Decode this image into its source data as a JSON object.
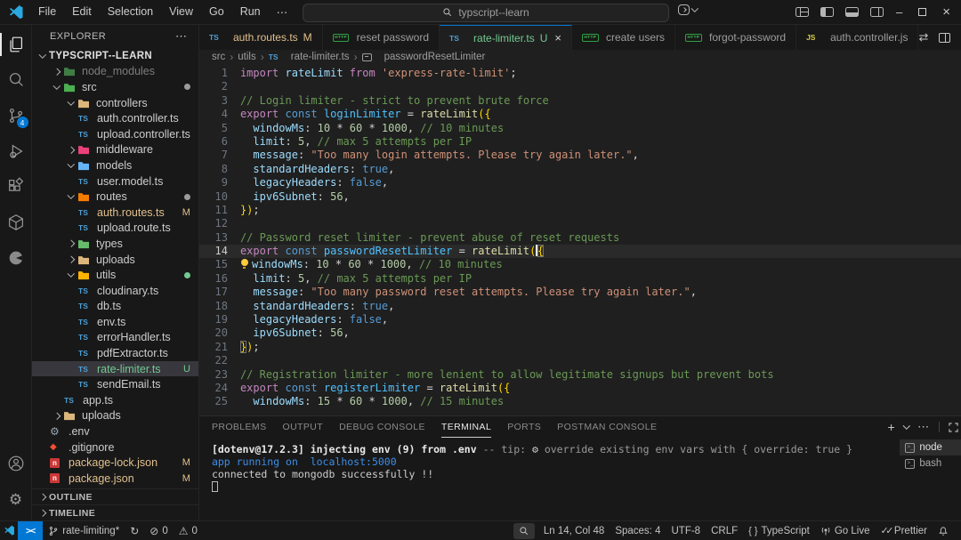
{
  "title_bar": {
    "menus": [
      "File",
      "Edit",
      "Selection",
      "View",
      "Go",
      "Run",
      "⋯"
    ],
    "back": "←",
    "forward": "→",
    "search_value": "typscript--learn",
    "window": {
      "minimize": "–",
      "close": "×"
    }
  },
  "activity_bar": {
    "source_control_badge": "4"
  },
  "explorer": {
    "header": "EXPLORER",
    "header_more": "⋯",
    "root": "TYPSCRIPT--LEARN",
    "tree": [
      {
        "label": "node_modules",
        "type": "folder",
        "color": "#3f7d44",
        "depth": 1,
        "chev": "right",
        "dim": true
      },
      {
        "label": "src",
        "type": "folder",
        "color": "#4caf50",
        "depth": 1,
        "chev": "down",
        "dot": "#9b9b9b"
      },
      {
        "label": "controllers",
        "type": "folder",
        "color": "#dcb67a",
        "depth": 2,
        "chev": "down"
      },
      {
        "label": "auth.controller.ts",
        "type": "ts",
        "depth": 3
      },
      {
        "label": "upload.controller.ts",
        "type": "ts",
        "depth": 3
      },
      {
        "label": "middleware",
        "type": "folder",
        "color": "#ec407a",
        "depth": 2,
        "chev": "right"
      },
      {
        "label": "models",
        "type": "folder",
        "color": "#64b5f6",
        "depth": 2,
        "chev": "down"
      },
      {
        "label": "user.model.ts",
        "type": "ts",
        "depth": 3
      },
      {
        "label": "routes",
        "type": "folder",
        "color": "#f57c00",
        "depth": 2,
        "chev": "down",
        "dot": "#9b9b9b"
      },
      {
        "label": "auth.routes.ts",
        "type": "ts",
        "depth": 3,
        "badge": "M",
        "label_color": "#e2c08d",
        "badge_color": "#e2c08d"
      },
      {
        "label": "upload.route.ts",
        "type": "ts",
        "depth": 3
      },
      {
        "label": "types",
        "type": "folder",
        "color": "#66bb6a",
        "depth": 2,
        "chev": "right"
      },
      {
        "label": "uploads",
        "type": "folder",
        "color": "#dcb67a",
        "depth": 2,
        "chev": "right"
      },
      {
        "label": "utils",
        "type": "folder",
        "color": "#ffb300",
        "depth": 2,
        "chev": "down",
        "dot": "#73c991"
      },
      {
        "label": "cloudinary.ts",
        "type": "ts",
        "depth": 3
      },
      {
        "label": "db.ts",
        "type": "ts",
        "depth": 3
      },
      {
        "label": "env.ts",
        "type": "ts",
        "depth": 3
      },
      {
        "label": "errorHandler.ts",
        "type": "ts",
        "depth": 3
      },
      {
        "label": "pdfExtractor.ts",
        "type": "ts",
        "depth": 3
      },
      {
        "label": "rate-limiter.ts",
        "type": "ts",
        "depth": 3,
        "badge": "U",
        "selected": true,
        "label_color": "#73c991",
        "badge_color": "#73c991"
      },
      {
        "label": "sendEmail.ts",
        "type": "ts",
        "depth": 3
      },
      {
        "label": "app.ts",
        "type": "ts",
        "depth": 2
      },
      {
        "label": "uploads",
        "type": "folder",
        "color": "#dcb67a",
        "depth": 1,
        "chev": "right"
      },
      {
        "label": ".env",
        "type": "gear",
        "depth": 1
      },
      {
        "label": ".gitignore",
        "type": "git",
        "depth": 1
      },
      {
        "label": "package-lock.json",
        "type": "npm",
        "depth": 1,
        "badge": "M",
        "label_color": "#e2c08d",
        "badge_color": "#e2c08d"
      },
      {
        "label": "package.json",
        "type": "npm",
        "depth": 1,
        "badge": "M",
        "label_color": "#e2c08d",
        "badge_color": "#e2c08d"
      }
    ],
    "sections": [
      "OUTLINE",
      "TIMELINE"
    ]
  },
  "tabs": [
    {
      "kind": "ts",
      "label": "auth.routes.ts",
      "badge": "M",
      "label_color": "#e2c08d",
      "badge_color": "#e2c08d"
    },
    {
      "kind": "http",
      "label": "reset password"
    },
    {
      "kind": "ts",
      "label": "rate-limiter.ts",
      "badge": "U",
      "active": true,
      "label_color": "#73c991",
      "badge_color": "#73c991",
      "close": "×"
    },
    {
      "kind": "http",
      "label": "create users"
    },
    {
      "kind": "http",
      "label": "forgot-password"
    },
    {
      "kind": "js",
      "label": "auth.controller.js"
    }
  ],
  "breadcrumb": [
    {
      "t": "src"
    },
    {
      "t": "utils"
    },
    {
      "t": "rate-limiter.ts",
      "icon": "ts"
    },
    {
      "t": "passwordResetLimiter",
      "icon": "sym"
    }
  ],
  "code": {
    "lines": [
      {
        "n": 1,
        "t": [
          [
            "k",
            "import "
          ],
          [
            "v",
            "rateLimit "
          ],
          [
            "k",
            "from "
          ],
          [
            "s",
            "'express-rate-limit'"
          ],
          [
            "p",
            ";"
          ]
        ]
      },
      {
        "n": 2,
        "t": []
      },
      {
        "n": 3,
        "t": [
          [
            "cm",
            "// Login limiter - strict to prevent brute force"
          ]
        ]
      },
      {
        "n": 4,
        "t": [
          [
            "k",
            "export "
          ],
          [
            "d",
            "const "
          ],
          [
            "cn",
            "loginLimiter "
          ],
          [
            "p",
            "= "
          ],
          [
            "fn",
            "rateLimit"
          ],
          [
            "b",
            "({"
          ]
        ]
      },
      {
        "n": 5,
        "t": [
          [
            "p",
            "  "
          ],
          [
            "v",
            "windowMs"
          ],
          [
            "p",
            ": "
          ],
          [
            "n",
            "10"
          ],
          [
            "p",
            " * "
          ],
          [
            "n",
            "60"
          ],
          [
            "p",
            " * "
          ],
          [
            "n",
            "1000"
          ],
          [
            "p",
            ", "
          ],
          [
            "cm",
            "// 10 minutes"
          ]
        ]
      },
      {
        "n": 6,
        "t": [
          [
            "p",
            "  "
          ],
          [
            "v",
            "limit"
          ],
          [
            "p",
            ": "
          ],
          [
            "n",
            "5"
          ],
          [
            "p",
            ", "
          ],
          [
            "cm",
            "// max 5 attempts per IP"
          ]
        ]
      },
      {
        "n": 7,
        "t": [
          [
            "p",
            "  "
          ],
          [
            "v",
            "message"
          ],
          [
            "p",
            ": "
          ],
          [
            "s",
            "\"Too many login attempts. Please try again later.\""
          ],
          [
            "p",
            ","
          ]
        ]
      },
      {
        "n": 8,
        "t": [
          [
            "p",
            "  "
          ],
          [
            "v",
            "standardHeaders"
          ],
          [
            "p",
            ": "
          ],
          [
            "d",
            "true"
          ],
          [
            "p",
            ","
          ]
        ]
      },
      {
        "n": 9,
        "t": [
          [
            "p",
            "  "
          ],
          [
            "v",
            "legacyHeaders"
          ],
          [
            "p",
            ": "
          ],
          [
            "d",
            "false"
          ],
          [
            "p",
            ","
          ]
        ]
      },
      {
        "n": 10,
        "t": [
          [
            "p",
            "  "
          ],
          [
            "v",
            "ipv6Subnet"
          ],
          [
            "p",
            ": "
          ],
          [
            "n",
            "56"
          ],
          [
            "p",
            ","
          ]
        ]
      },
      {
        "n": 11,
        "t": [
          [
            "b",
            "})"
          ],
          [
            "p",
            ";"
          ]
        ]
      },
      {
        "n": 12,
        "t": []
      },
      {
        "n": 13,
        "t": [
          [
            "cm",
            "// Password reset limiter - prevent abuse of reset requests"
          ]
        ]
      },
      {
        "n": 14,
        "cur": true,
        "t": [
          [
            "k",
            "export "
          ],
          [
            "d",
            "const "
          ],
          [
            "cn",
            "passwordResetLimiter "
          ],
          [
            "p",
            "= "
          ],
          [
            "fn",
            "rateLimit"
          ],
          [
            "b",
            "("
          ],
          [
            "cursor",
            ""
          ],
          [
            "bm",
            "{"
          ]
        ]
      },
      {
        "n": 15,
        "bulb": true,
        "t": [
          [
            "v",
            "windowMs"
          ],
          [
            "p",
            ": "
          ],
          [
            "n",
            "10"
          ],
          [
            "p",
            " * "
          ],
          [
            "n",
            "60"
          ],
          [
            "p",
            " * "
          ],
          [
            "n",
            "1000"
          ],
          [
            "p",
            ", "
          ],
          [
            "cm",
            "// 10 minutes"
          ]
        ]
      },
      {
        "n": 16,
        "t": [
          [
            "p",
            "  "
          ],
          [
            "v",
            "limit"
          ],
          [
            "p",
            ": "
          ],
          [
            "n",
            "5"
          ],
          [
            "p",
            ", "
          ],
          [
            "cm",
            "// max 5 attempts per IP"
          ]
        ]
      },
      {
        "n": 17,
        "t": [
          [
            "p",
            "  "
          ],
          [
            "v",
            "message"
          ],
          [
            "p",
            ": "
          ],
          [
            "s",
            "\"Too many password reset attempts. Please try again later.\""
          ],
          [
            "p",
            ","
          ]
        ]
      },
      {
        "n": 18,
        "t": [
          [
            "p",
            "  "
          ],
          [
            "v",
            "standardHeaders"
          ],
          [
            "p",
            ": "
          ],
          [
            "d",
            "true"
          ],
          [
            "p",
            ","
          ]
        ]
      },
      {
        "n": 19,
        "t": [
          [
            "p",
            "  "
          ],
          [
            "v",
            "legacyHeaders"
          ],
          [
            "p",
            ": "
          ],
          [
            "d",
            "false"
          ],
          [
            "p",
            ","
          ]
        ]
      },
      {
        "n": 20,
        "t": [
          [
            "p",
            "  "
          ],
          [
            "v",
            "ipv6Subnet"
          ],
          [
            "p",
            ": "
          ],
          [
            "n",
            "56"
          ],
          [
            "p",
            ","
          ]
        ]
      },
      {
        "n": 21,
        "t": [
          [
            "bm",
            "}"
          ],
          [
            "b",
            ")"
          ],
          [
            "p",
            ";"
          ]
        ]
      },
      {
        "n": 22,
        "t": []
      },
      {
        "n": 23,
        "t": [
          [
            "cm",
            "// Registration limiter - more lenient to allow legitimate signups but prevent bots"
          ]
        ]
      },
      {
        "n": 24,
        "t": [
          [
            "k",
            "export "
          ],
          [
            "d",
            "const "
          ],
          [
            "cn",
            "registerLimiter "
          ],
          [
            "p",
            "= "
          ],
          [
            "fn",
            "rateLimit"
          ],
          [
            "b",
            "({"
          ]
        ]
      },
      {
        "n": 25,
        "t": [
          [
            "p",
            "  "
          ],
          [
            "v",
            "windowMs"
          ],
          [
            "p",
            ": "
          ],
          [
            "n",
            "15"
          ],
          [
            "p",
            " * "
          ],
          [
            "n",
            "60"
          ],
          [
            "p",
            " * "
          ],
          [
            "n",
            "1000"
          ],
          [
            "p",
            ", "
          ],
          [
            "cm",
            "// 15 minutes"
          ]
        ]
      }
    ]
  },
  "panel": {
    "tabs": [
      "PROBLEMS",
      "OUTPUT",
      "DEBUG CONSOLE",
      "TERMINAL",
      "PORTS",
      "POSTMAN CONSOLE"
    ],
    "active_tab": "TERMINAL",
    "terminal_lines": [
      [
        [
          "tb",
          "[dotenv@17.2.3] injecting env (9) from .env "
        ],
        [
          "td",
          "-- tip: "
        ],
        [
          "tg",
          "⚙ "
        ],
        [
          "td",
          "override existing env vars with { override: true }"
        ]
      ],
      [
        [
          "tblue",
          "app running on  localhost:5000"
        ]
      ],
      [
        [
          "tw",
          "connected to mongodb successfully !!"
        ]
      ],
      [
        [
          "tcur",
          ""
        ]
      ]
    ],
    "terminals": [
      {
        "name": "node",
        "selected": true
      },
      {
        "name": "bash"
      }
    ]
  },
  "status_bar": {
    "remote_label": "><",
    "left": [
      {
        "name": "git-branch",
        "icon": "branch",
        "label": "rate-limiting*"
      },
      {
        "name": "sync",
        "icon": "sync",
        "label": ""
      },
      {
        "name": "problems-errors",
        "icon": "error",
        "label": "0"
      },
      {
        "name": "problems-warnings",
        "icon": "warning",
        "label": "0"
      }
    ],
    "right": [
      {
        "name": "search-toggle",
        "icon": "search",
        "label": "",
        "boxed": true
      },
      {
        "name": "cursor-position",
        "icon": "",
        "label": "Ln 14, Col 48"
      },
      {
        "name": "indentation",
        "icon": "",
        "label": "Spaces: 4"
      },
      {
        "name": "encoding",
        "icon": "",
        "label": "UTF-8"
      },
      {
        "name": "eol",
        "icon": "",
        "label": "CRLF"
      },
      {
        "name": "language-mode",
        "icon": "braces",
        "label": "TypeScript"
      },
      {
        "name": "go-live",
        "icon": "tower",
        "label": "Go Live"
      },
      {
        "name": "prettier",
        "icon": "checks",
        "label": "Prettier"
      },
      {
        "name": "notifications",
        "icon": "bell",
        "label": ""
      }
    ]
  }
}
